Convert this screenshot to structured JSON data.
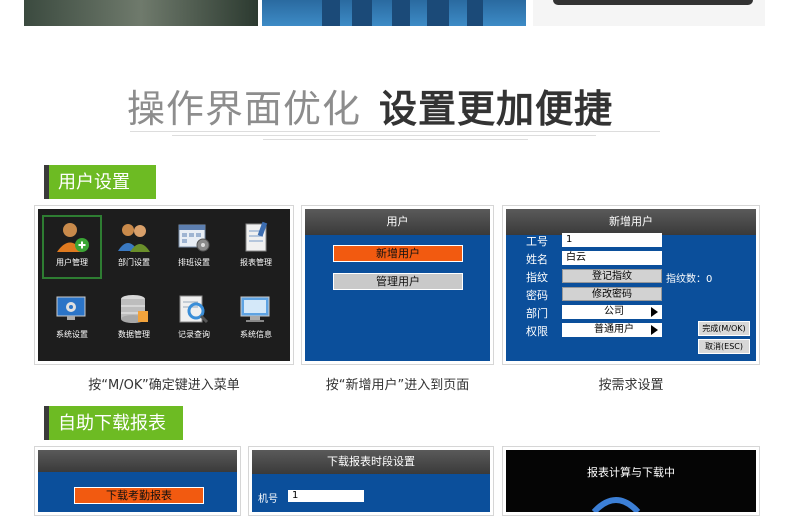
{
  "header": {
    "title_light": "操作界面优化",
    "title_bold": "设置更加便捷"
  },
  "section1": {
    "title": "用户设置",
    "panel1": {
      "items": [
        "用户管理",
        "部门设置",
        "排班设置",
        "报表管理",
        "系统设置",
        "数据管理",
        "记录查询",
        "系统信息"
      ],
      "caption": "按“M/OK”确定键进入菜单"
    },
    "panel2": {
      "title": "用户",
      "btn_new": "新增用户",
      "btn_manage": "管理用户",
      "caption": "按“新增用户”进入到页面"
    },
    "panel3": {
      "title": "新增用户",
      "labels": {
        "id": "工号",
        "name": "姓名",
        "fp": "指纹",
        "pwd": "密码",
        "dept": "部门",
        "perm": "权限"
      },
      "values": {
        "id": "1",
        "name": "白云",
        "fp_btn": "登记指纹",
        "fp_count_label": "指纹数：",
        "fp_count": "0",
        "pwd_btn": "修改密码",
        "dept": "公司",
        "perm": "普通用户"
      },
      "btn_done": "完成(M/OK)",
      "btn_cancel": "取消(ESC)",
      "caption": "按需求设置"
    }
  },
  "section2": {
    "title": "自助下载报表",
    "panel1": {
      "btn": "下载考勤报表"
    },
    "panel2": {
      "title": "下载报表时段设置",
      "label": "机号",
      "value": "1"
    },
    "panel3": {
      "title": "报表计算与下载中"
    }
  }
}
